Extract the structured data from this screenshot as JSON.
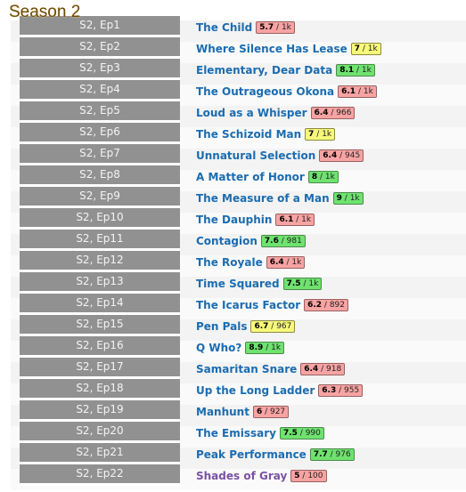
{
  "season": {
    "title": "Season 2"
  },
  "colors": {
    "rating_low": "#f8a3a3",
    "rating_mid": "#f8f87a",
    "rating_high": "#6fe26f",
    "link": "#1b6cb0",
    "link_visited": "#7a52a2",
    "episode_cell": "#919191"
  },
  "episodes": [
    {
      "label": "S2, Ep1",
      "title": "The Child",
      "score": "5.7",
      "votes": "1k",
      "level": "red"
    },
    {
      "label": "S2, Ep2",
      "title": "Where Silence Has Lease",
      "score": "7",
      "votes": "1k",
      "level": "yellow"
    },
    {
      "label": "S2, Ep3",
      "title": "Elementary, Dear Data",
      "score": "8.1",
      "votes": "1k",
      "level": "green"
    },
    {
      "label": "S2, Ep4",
      "title": "The Outrageous Okona",
      "score": "6.1",
      "votes": "1k",
      "level": "red"
    },
    {
      "label": "S2, Ep5",
      "title": "Loud as a Whisper",
      "score": "6.4",
      "votes": "966",
      "level": "red"
    },
    {
      "label": "S2, Ep6",
      "title": "The Schizoid Man",
      "score": "7",
      "votes": "1k",
      "level": "yellow"
    },
    {
      "label": "S2, Ep7",
      "title": "Unnatural Selection",
      "score": "6.4",
      "votes": "945",
      "level": "red"
    },
    {
      "label": "S2, Ep8",
      "title": "A Matter of Honor",
      "score": "8",
      "votes": "1k",
      "level": "green"
    },
    {
      "label": "S2, Ep9",
      "title": "The Measure of a Man",
      "score": "9",
      "votes": "1k",
      "level": "green"
    },
    {
      "label": "S2, Ep10",
      "title": "The Dauphin",
      "score": "6.1",
      "votes": "1k",
      "level": "red"
    },
    {
      "label": "S2, Ep11",
      "title": "Contagion",
      "score": "7.6",
      "votes": "981",
      "level": "green"
    },
    {
      "label": "S2, Ep12",
      "title": "The Royale",
      "score": "6.4",
      "votes": "1k",
      "level": "red"
    },
    {
      "label": "S2, Ep13",
      "title": "Time Squared",
      "score": "7.5",
      "votes": "1k",
      "level": "green"
    },
    {
      "label": "S2, Ep14",
      "title": "The Icarus Factor",
      "score": "6.2",
      "votes": "892",
      "level": "red"
    },
    {
      "label": "S2, Ep15",
      "title": "Pen Pals",
      "score": "6.7",
      "votes": "967",
      "level": "yellow"
    },
    {
      "label": "S2, Ep16",
      "title": "Q Who?",
      "score": "8.9",
      "votes": "1k",
      "level": "green"
    },
    {
      "label": "S2, Ep17",
      "title": "Samaritan Snare",
      "score": "6.4",
      "votes": "918",
      "level": "red"
    },
    {
      "label": "S2, Ep18",
      "title": "Up the Long Ladder",
      "score": "6.3",
      "votes": "955",
      "level": "red"
    },
    {
      "label": "S2, Ep19",
      "title": "Manhunt",
      "score": "6",
      "votes": "927",
      "level": "red"
    },
    {
      "label": "S2, Ep20",
      "title": "The Emissary",
      "score": "7.5",
      "votes": "990",
      "level": "green"
    },
    {
      "label": "S2, Ep21",
      "title": "Peak Performance",
      "score": "7.7",
      "votes": "976",
      "level": "green"
    },
    {
      "label": "S2, Ep22",
      "title": "Shades of Gray",
      "score": "5",
      "votes": "100",
      "level": "red",
      "visited": true
    }
  ]
}
